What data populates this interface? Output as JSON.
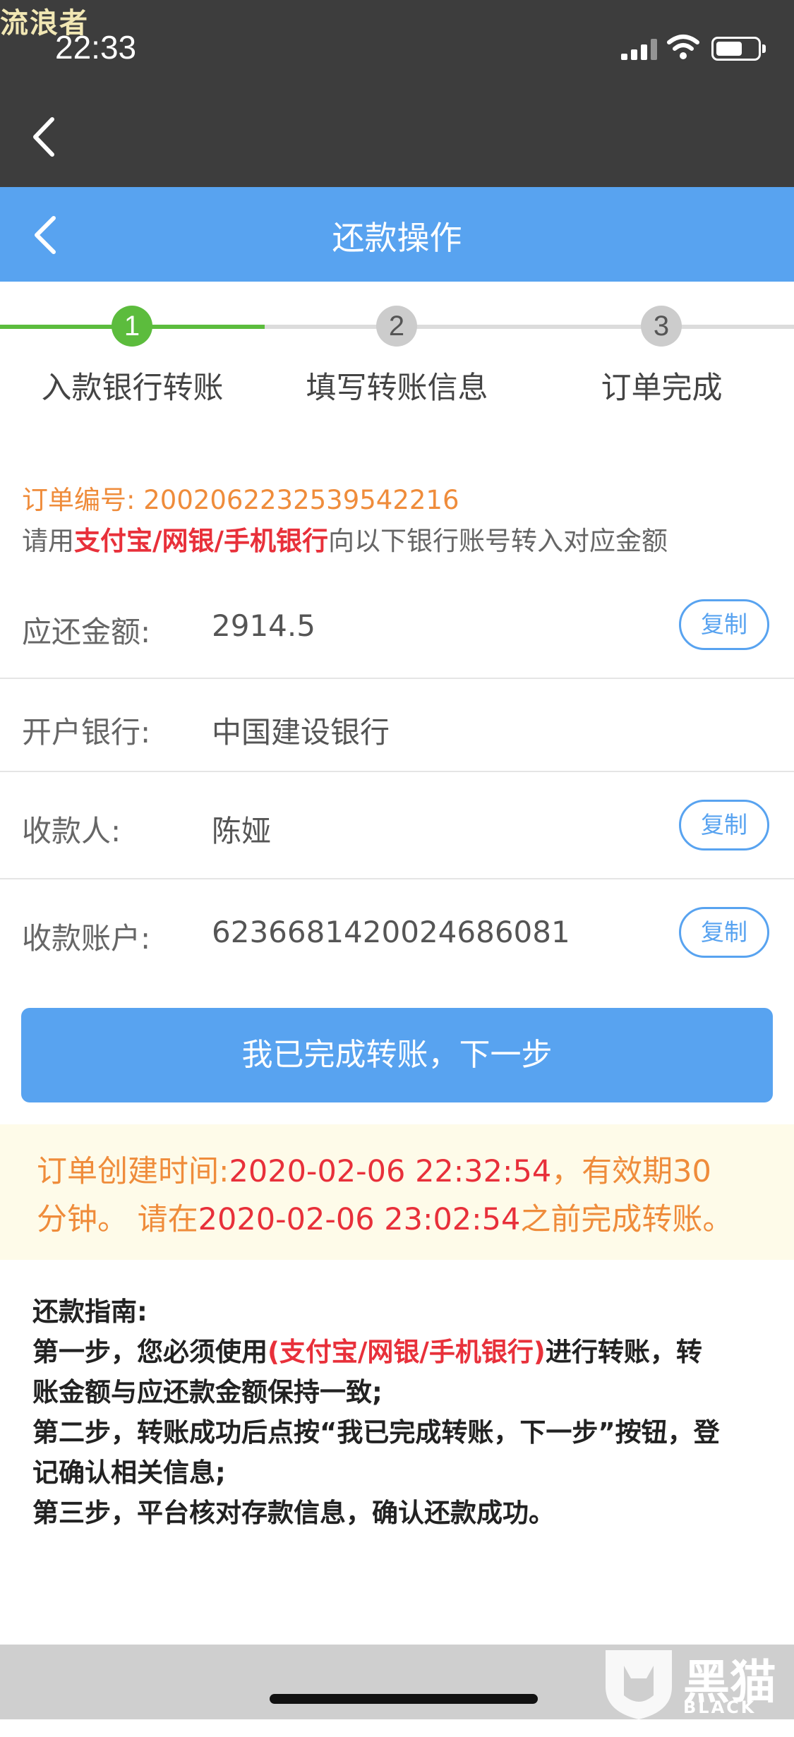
{
  "status_bar": {
    "watermark": "流浪者",
    "time": "22:33",
    "back_icon": "chevron-left-icon"
  },
  "header": {
    "title": "还款操作",
    "back_icon": "chevron-left-icon"
  },
  "steps": [
    {
      "number": "1",
      "label": "入款银行转账",
      "active": true
    },
    {
      "number": "2",
      "label": "填写转账信息",
      "active": false
    },
    {
      "number": "3",
      "label": "订单完成",
      "active": false
    }
  ],
  "order": {
    "label": "订单编号:",
    "number": "2002062232539542216"
  },
  "instruction": {
    "prefix": "请用",
    "highlight": "支付宝/网银/手机银行",
    "suffix": "向以下银行账号转入对应金额"
  },
  "info_rows": [
    {
      "label": "应还金额:",
      "value": "2914.5",
      "copy": "复制"
    },
    {
      "label": "开户银行:",
      "value": "中国建设银行"
    },
    {
      "label": "收款人:",
      "value": "陈娅",
      "copy": "复制"
    },
    {
      "label": "收款账户:",
      "value": "6236681420024686081",
      "copy": "复制"
    }
  ],
  "primary_button": "我已完成转账，下一步",
  "notice": {
    "p1": "订单创建时间:",
    "created": "2020-02-06 22:32:54",
    "p2": "，有效期30",
    "p3": "分钟。 请在",
    "deadline": "2020-02-06 23:02:54",
    "p4": "之前完成转账。"
  },
  "guide": {
    "title": "还款指南:",
    "step1_a": "第一步，您必须使用",
    "step1_red": "(支付宝/网银/手机银行)",
    "step1_b": "进行转账，转",
    "step1_c": "账金额与应还款金额保持一致;",
    "step2_a": "第二步，转账成功后点按“我已完成转账，下一步”按钮，登",
    "step2_b": "记确认相关信息;",
    "step3": "第三步，平台核对存款信息，确认还款成功。"
  },
  "watermark_logo": {
    "cn": "黑猫",
    "en": "BLACK CAT"
  },
  "colors": {
    "header_blue": "#58a3f0",
    "step_green": "#5cbc3d",
    "orange": "#ef8c3b",
    "red": "#e8303a"
  }
}
